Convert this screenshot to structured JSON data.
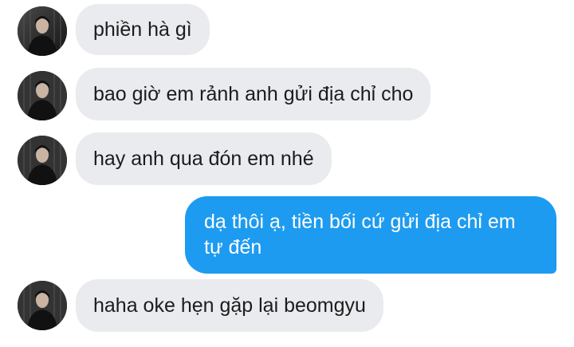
{
  "messages": [
    {
      "sender": "other",
      "text": "phiền hà gì"
    },
    {
      "sender": "other",
      "text": "bao giờ em rảnh anh gửi địa chỉ cho"
    },
    {
      "sender": "other",
      "text": "hay anh qua đón em nhé"
    },
    {
      "sender": "me",
      "lines": [
        "dạ thôi ạ, tiền bối cứ gửi địa chỉ em",
        "tự đến"
      ]
    },
    {
      "sender": "other",
      "text": "haha oke hẹn gặp lại beomgyu"
    }
  ],
  "colors": {
    "incoming_bubble": "#e9ebee",
    "outgoing_bubble": "#1d9bf0",
    "incoming_text": "#1c1c1c",
    "outgoing_text": "#ffffff"
  }
}
